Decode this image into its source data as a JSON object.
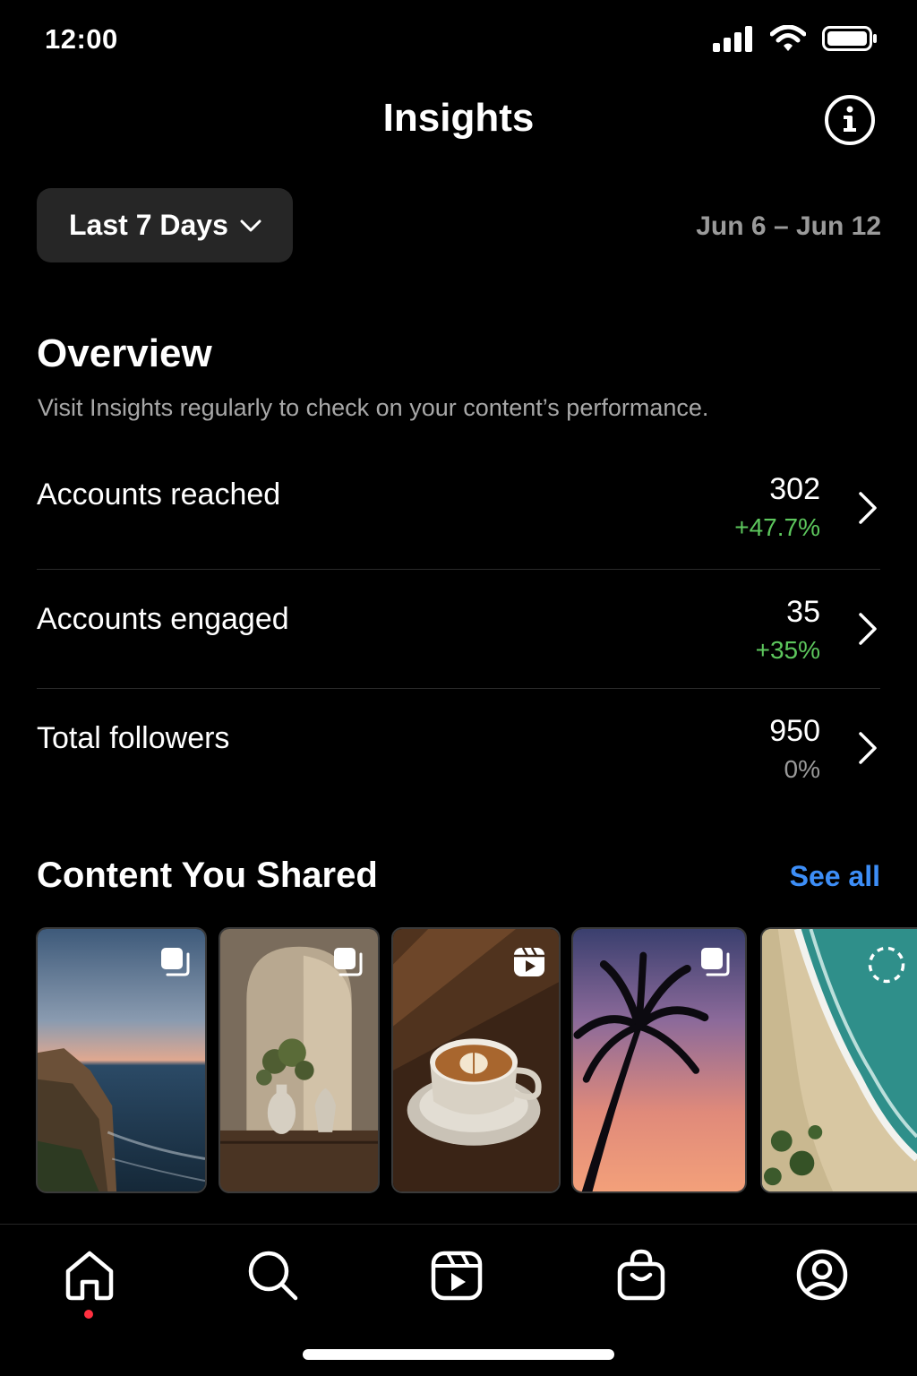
{
  "status": {
    "time": "12:00"
  },
  "header": {
    "title": "Insights"
  },
  "filters": {
    "range_label": "Last 7 Days",
    "date_range": "Jun 6 – Jun 12"
  },
  "overview": {
    "title": "Overview",
    "subtitle": "Visit Insights regularly to check on your content’s performance.",
    "metrics": [
      {
        "label": "Accounts reached",
        "value": "302",
        "change": "+47.7%",
        "trend": "positive"
      },
      {
        "label": "Accounts engaged",
        "value": "35",
        "change": "+35%",
        "trend": "positive"
      },
      {
        "label": "Total followers",
        "value": "950",
        "change": "0%",
        "trend": "neutral"
      }
    ]
  },
  "content": {
    "title": "Content You Shared",
    "see_all": "See all",
    "items": [
      {
        "subject": "sea cliff at sunset",
        "type": "carousel"
      },
      {
        "subject": "vases in arched alcove",
        "type": "carousel"
      },
      {
        "subject": "latte art coffee",
        "type": "reel"
      },
      {
        "subject": "palm tree at sunset",
        "type": "carousel"
      },
      {
        "subject": "aerial beach",
        "type": "story"
      }
    ]
  },
  "tab_bar": {
    "tabs": [
      "home",
      "search",
      "reels",
      "shop",
      "profile"
    ],
    "active": "home"
  },
  "colors": {
    "background": "#000000",
    "positive": "#5dc75d",
    "link": "#3d8ef7",
    "notification": "#ff3040"
  }
}
